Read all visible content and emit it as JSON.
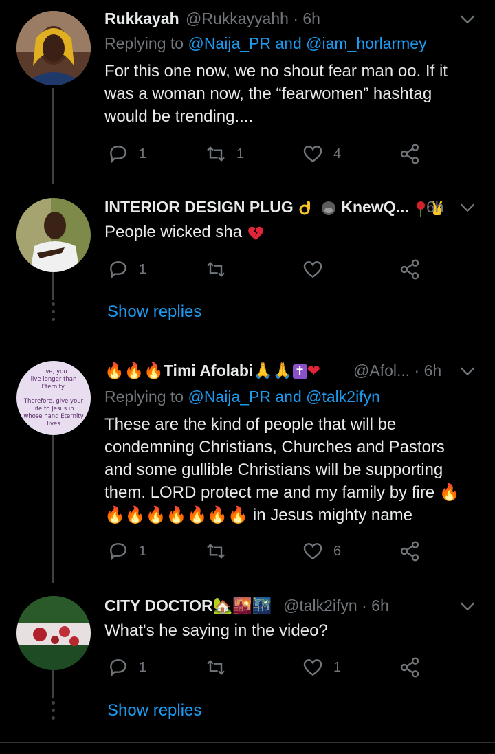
{
  "tweets": [
    {
      "name": "Rukkayah",
      "handle": "@Rukkayyahh",
      "time": "· 6h",
      "reply_prefix": "Replying to ",
      "reply_user1": "@Naija_PR",
      "reply_and": " and ",
      "reply_user2": "@iam_horlarmey",
      "text": "For this one now, we no shout fear man oo. If it was a woman now, the “fearwomen” hashtag would be trending....",
      "replies": "1",
      "retweets": "1",
      "likes": "4"
    },
    {
      "name": "INTERIOR DESIGN PLUG",
      "handle": "KnewQ...",
      "time": "6h",
      "text": "People wicked sha",
      "replies": "1",
      "retweets": "",
      "likes": "",
      "show_replies": "Show replies"
    },
    {
      "name": "Timi Afolabi",
      "handle": "@Afol...",
      "time": "· 6h",
      "reply_prefix": "Replying to ",
      "reply_user1": "@Naija_PR",
      "reply_and": " and ",
      "reply_user2": "@talk2ifyn",
      "text_lines": [
        "These are the kind of people that will be",
        "condemning Christians, Churches and Pastors",
        "and some gullible Christians will be supporting",
        "them. LORD protect me and my family by fire",
        "in Jesus mighty name"
      ],
      "replies": "1",
      "retweets": "",
      "likes": "6",
      "avatar_text": [
        "...ve, you",
        "live longer than",
        "Eternity.",
        "Therefore, give your",
        "life to Jesus in",
        "whose hand Eternity",
        "lives"
      ]
    },
    {
      "name": "CITY DOCTOR",
      "handle": "@talk2ifyn",
      "time": "· 6h",
      "text": "What's he saying in the video?",
      "replies": "1",
      "retweets": "",
      "likes": "1",
      "show_replies": "Show replies"
    }
  ],
  "colors": {
    "background": "#000000",
    "text": "#e7e9ea",
    "secondary": "#71767b",
    "link": "#1d9bf0",
    "thread_line": "#3d4146"
  }
}
